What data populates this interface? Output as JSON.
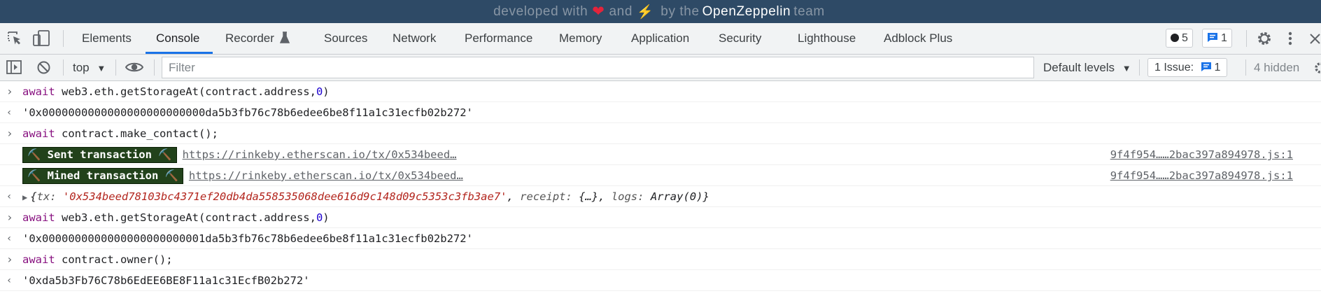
{
  "banner": {
    "prefix": "developed with",
    "and": "and",
    "by_the": "by the",
    "brand": "OpenZeppelin",
    "suffix": "team"
  },
  "tabs": [
    "Elements",
    "Console",
    "Recorder",
    "Sources",
    "Network",
    "Performance",
    "Memory",
    "Application",
    "Security",
    "Lighthouse",
    "Adblock Plus"
  ],
  "active_tab": "Console",
  "counts": {
    "errors": "5",
    "messages": "1"
  },
  "toolbar": {
    "context": "top",
    "filter_placeholder": "Filter",
    "levels": "Default levels",
    "issues_label": "1 Issue:",
    "issues_count": "1",
    "hidden": "4 hidden"
  },
  "console": {
    "cmd1": {
      "prefix": "await",
      "text": " web3.eth.getStorageAt(contract.address,",
      "num": "0",
      "close": ")"
    },
    "res1": "'0x0000000000000000000000000da5b3fb76c78b6edee6be8f11a1c31ecfb02b272'",
    "cmd2": {
      "prefix": "await",
      "text": " contract.make_contact();"
    },
    "log1": {
      "badge": "⛏️ Sent transaction ⛏️",
      "link": "https://rinkeby.etherscan.io/tx/0x534beed…",
      "source": "9f4f954……2bac397a894978.js:1"
    },
    "log2": {
      "badge": "⛏️ Mined transaction ⛏️",
      "link": "https://rinkeby.etherscan.io/tx/0x534beed…",
      "source": "9f4f954……2bac397a894978.js:1"
    },
    "res2": {
      "open": "{",
      "k1": "tx:",
      "v1": "'0x534beed78103bc4371ef20db4da558535068dee616d9c148d09c5353c3fb3ae7'",
      "sep1": ", ",
      "k2": "receipt:",
      "v2": " {…}",
      "sep2": ", ",
      "k3": "logs:",
      "v3": " Array(0)",
      "close": "}"
    },
    "cmd3": {
      "prefix": "await",
      "text": " web3.eth.getStorageAt(contract.address,",
      "num": "0",
      "close": ")"
    },
    "res3": "'0x0000000000000000000000001da5b3fb76c78b6edee6be8f11a1c31ecfb02b272'",
    "cmd4": {
      "prefix": "await",
      "text": " contract.owner();"
    },
    "res4": "'0xda5b3Fb76C78b6EdEE6BE8F11a1c31EcfB02b272'"
  },
  "colors": {
    "banner_bg": "#2e4a66",
    "accent": "#1a73e8",
    "string": "#b3261e",
    "keyword": "#881280",
    "badge_bg": "#22421b"
  }
}
